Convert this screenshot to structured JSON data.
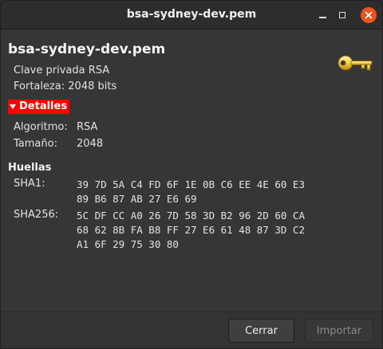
{
  "window": {
    "title": "bsa-sydney-dev.pem"
  },
  "header": {
    "filename": "bsa-sydney-dev.pem",
    "type_line": "Clave privada RSA",
    "strength_line": "Fortaleza: 2048 bits",
    "icon": "key-icon"
  },
  "details": {
    "expander_label": "Detalles",
    "expanded": true,
    "algorithm_label": "Algoritmo:",
    "algorithm_value": "RSA",
    "size_label": "Tamaño:",
    "size_value": "2048"
  },
  "fingerprints": {
    "title": "Huellas",
    "sha1_label": "SHA1:",
    "sha1_lines": [
      "39 7D 5A C4 FD 6F 1E 0B C6 EE 4E 60 E3",
      "89 B6 87 AB 27 E6 69"
    ],
    "sha256_label": "SHA256:",
    "sha256_lines": [
      "5C DF CC A0 26 7D 58 3D B2 96 2D 60 CA",
      "68 62 8B FA B8 FF 27 E6 61 48 87 3D C2",
      "A1 6F 29 75 30 80"
    ]
  },
  "footer": {
    "close_label": "Cerrar",
    "import_label": "Importar",
    "import_enabled": false
  },
  "colors": {
    "expander_highlight": "#ff0000",
    "close_button": "#e95420"
  }
}
